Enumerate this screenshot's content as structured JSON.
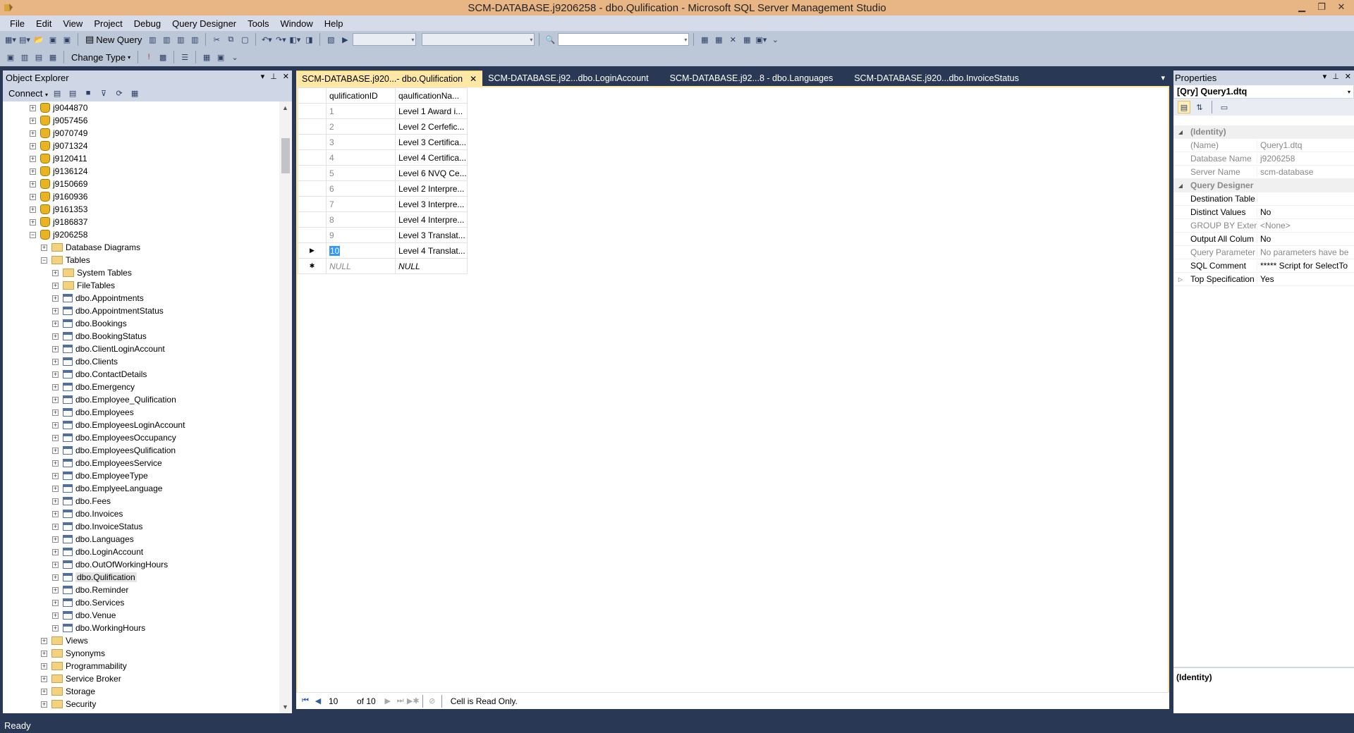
{
  "window": {
    "title": "SCM-DATABASE.j9206258 - dbo.Qulification - Microsoft SQL Server Management Studio",
    "controls": [
      "minimize",
      "restore",
      "close"
    ]
  },
  "menu": [
    "File",
    "Edit",
    "View",
    "Project",
    "Debug",
    "Query Designer",
    "Tools",
    "Window",
    "Help"
  ],
  "toolbar": {
    "new_query_label": "New Query",
    "change_type_label": "Change Type"
  },
  "object_explorer": {
    "title": "Object Explorer",
    "connect_label": "Connect",
    "tree": [
      {
        "label": "j9044870",
        "indent": 1,
        "type": "db",
        "exp": "+"
      },
      {
        "label": "j9057456",
        "indent": 1,
        "type": "db",
        "exp": "+"
      },
      {
        "label": "j9070749",
        "indent": 1,
        "type": "db",
        "exp": "+"
      },
      {
        "label": "j9071324",
        "indent": 1,
        "type": "db",
        "exp": "+"
      },
      {
        "label": "j9120411",
        "indent": 1,
        "type": "db",
        "exp": "+"
      },
      {
        "label": "j9136124",
        "indent": 1,
        "type": "db",
        "exp": "+"
      },
      {
        "label": "j9150669",
        "indent": 1,
        "type": "db",
        "exp": "+"
      },
      {
        "label": "j9160936",
        "indent": 1,
        "type": "db",
        "exp": "+"
      },
      {
        "label": "j9161353",
        "indent": 1,
        "type": "db",
        "exp": "+"
      },
      {
        "label": "j9186837",
        "indent": 1,
        "type": "db",
        "exp": "+"
      },
      {
        "label": "j9206258",
        "indent": 1,
        "type": "db",
        "exp": "−"
      },
      {
        "label": "Database Diagrams",
        "indent": 2,
        "type": "folder",
        "exp": "+"
      },
      {
        "label": "Tables",
        "indent": 2,
        "type": "folder",
        "exp": "−"
      },
      {
        "label": "System Tables",
        "indent": 3,
        "type": "folder",
        "exp": "+"
      },
      {
        "label": "FileTables",
        "indent": 3,
        "type": "folder",
        "exp": "+"
      },
      {
        "label": "dbo.Appointments",
        "indent": 3,
        "type": "table",
        "exp": "+"
      },
      {
        "label": "dbo.AppointmentStatus",
        "indent": 3,
        "type": "table",
        "exp": "+"
      },
      {
        "label": "dbo.Bookings",
        "indent": 3,
        "type": "table",
        "exp": "+"
      },
      {
        "label": "dbo.BookingStatus",
        "indent": 3,
        "type": "table",
        "exp": "+"
      },
      {
        "label": "dbo.ClientLoginAccount",
        "indent": 3,
        "type": "table",
        "exp": "+"
      },
      {
        "label": "dbo.Clients",
        "indent": 3,
        "type": "table",
        "exp": "+"
      },
      {
        "label": "dbo.ContactDetails",
        "indent": 3,
        "type": "table",
        "exp": "+"
      },
      {
        "label": "dbo.Emergency",
        "indent": 3,
        "type": "table",
        "exp": "+"
      },
      {
        "label": "dbo.Employee_Qulification",
        "indent": 3,
        "type": "table",
        "exp": "+"
      },
      {
        "label": "dbo.Employees",
        "indent": 3,
        "type": "table",
        "exp": "+"
      },
      {
        "label": "dbo.EmployeesLoginAccount",
        "indent": 3,
        "type": "table",
        "exp": "+"
      },
      {
        "label": "dbo.EmployeesOccupancy",
        "indent": 3,
        "type": "table",
        "exp": "+"
      },
      {
        "label": "dbo.EmployeesQulification",
        "indent": 3,
        "type": "table",
        "exp": "+"
      },
      {
        "label": "dbo.EmployeesService",
        "indent": 3,
        "type": "table",
        "exp": "+"
      },
      {
        "label": "dbo.EmployeeType",
        "indent": 3,
        "type": "table",
        "exp": "+"
      },
      {
        "label": "dbo.EmplyeeLanguage",
        "indent": 3,
        "type": "table",
        "exp": "+"
      },
      {
        "label": "dbo.Fees",
        "indent": 3,
        "type": "table",
        "exp": "+"
      },
      {
        "label": "dbo.Invoices",
        "indent": 3,
        "type": "table",
        "exp": "+"
      },
      {
        "label": "dbo.InvoiceStatus",
        "indent": 3,
        "type": "table",
        "exp": "+"
      },
      {
        "label": "dbo.Languages",
        "indent": 3,
        "type": "table",
        "exp": "+"
      },
      {
        "label": "dbo.LoginAccount",
        "indent": 3,
        "type": "table",
        "exp": "+"
      },
      {
        "label": "dbo.OutOfWorkingHours",
        "indent": 3,
        "type": "table",
        "exp": "+"
      },
      {
        "label": "dbo.Qulification",
        "indent": 3,
        "type": "table",
        "exp": "+",
        "selected": true
      },
      {
        "label": "dbo.Reminder",
        "indent": 3,
        "type": "table",
        "exp": "+"
      },
      {
        "label": "dbo.Services",
        "indent": 3,
        "type": "table",
        "exp": "+"
      },
      {
        "label": "dbo.Venue",
        "indent": 3,
        "type": "table",
        "exp": "+"
      },
      {
        "label": "dbo.WorkingHours",
        "indent": 3,
        "type": "table",
        "exp": "+"
      },
      {
        "label": "Views",
        "indent": 2,
        "type": "folder",
        "exp": "+"
      },
      {
        "label": "Synonyms",
        "indent": 2,
        "type": "folder",
        "exp": "+"
      },
      {
        "label": "Programmability",
        "indent": 2,
        "type": "folder",
        "exp": "+"
      },
      {
        "label": "Service Broker",
        "indent": 2,
        "type": "folder",
        "exp": "+"
      },
      {
        "label": "Storage",
        "indent": 2,
        "type": "folder",
        "exp": "+"
      },
      {
        "label": "Security",
        "indent": 2,
        "type": "folder",
        "exp": "+"
      }
    ]
  },
  "doc_tabs": [
    {
      "label": "SCM-DATABASE.j920...- dbo.Qulification",
      "active": true
    },
    {
      "label": "SCM-DATABASE.j92...dbo.LoginAccount",
      "active": false
    },
    {
      "label": "SCM-DATABASE.j92...8 - dbo.Languages",
      "active": false
    },
    {
      "label": "SCM-DATABASE.j920...dbo.InvoiceStatus",
      "active": false
    }
  ],
  "grid": {
    "columns": [
      "qulificationID",
      "qaulficationNa..."
    ],
    "rows": [
      [
        "1",
        "Level 1 Award i..."
      ],
      [
        "2",
        "Level 2 Cerfefic..."
      ],
      [
        "3",
        "Level 3 Certifica..."
      ],
      [
        "4",
        "Level 4 Certifica..."
      ],
      [
        "5",
        "Level 6 NVQ Ce..."
      ],
      [
        "6",
        "Level 2 Interpre..."
      ],
      [
        "7",
        "Level 3 Interpre..."
      ],
      [
        "8",
        "Level 4 Interpre..."
      ],
      [
        "9",
        "Level 3 Translat..."
      ],
      [
        "10",
        "Level 4 Translat..."
      ]
    ],
    "new_row": [
      "NULL",
      "NULL"
    ],
    "current_row_index": 9
  },
  "navigator": {
    "position": "10",
    "of_label": "of 10",
    "status": "Cell is Read Only."
  },
  "properties": {
    "title": "Properties",
    "object": "[Qry] Query1.dtq",
    "rows": [
      {
        "kind": "cat",
        "name": "(Identity)",
        "expander": "◢"
      },
      {
        "kind": "ro",
        "name": "(Name)",
        "value": "Query1.dtq"
      },
      {
        "kind": "ro",
        "name": "Database Name",
        "value": "j9206258"
      },
      {
        "kind": "ro",
        "name": "Server Name",
        "value": "scm-database"
      },
      {
        "kind": "cat",
        "name": "Query Designer",
        "expander": "◢"
      },
      {
        "kind": "prop",
        "name": "Destination Table",
        "value": ""
      },
      {
        "kind": "prop",
        "name": "Distinct Values",
        "value": "No"
      },
      {
        "kind": "ro",
        "name": "GROUP BY Extensi",
        "value": "<None>"
      },
      {
        "kind": "prop",
        "name": "Output All Colum",
        "value": "No"
      },
      {
        "kind": "ro",
        "name": "Query Parameter l",
        "value": "No parameters have be"
      },
      {
        "kind": "prop",
        "name": "SQL Comment",
        "value": "***** Script for SelectTo"
      },
      {
        "kind": "prop",
        "name": "Top Specification",
        "value": "Yes",
        "expander": "▷"
      }
    ],
    "description_title": "(Identity)"
  },
  "status_bar": {
    "text": "Ready"
  },
  "colors": {
    "chrome": "#293955",
    "title_bar": "#e8b685",
    "active_tab": "#ffe8a6",
    "selection": "#3399ff"
  }
}
